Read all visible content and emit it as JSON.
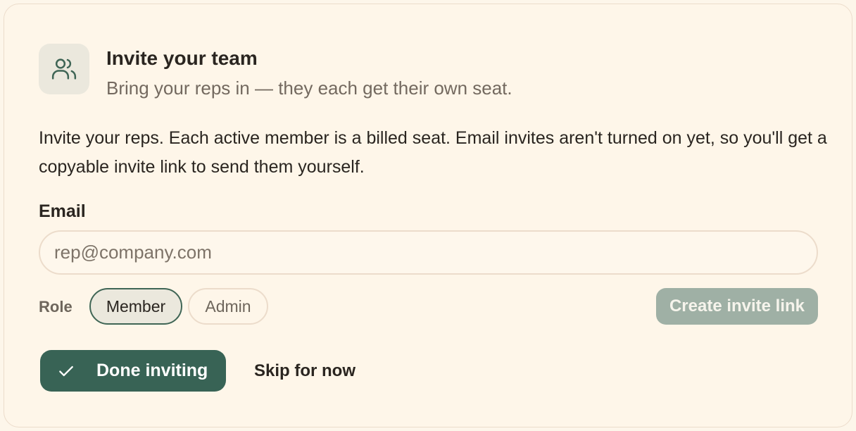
{
  "header": {
    "icon": "users-icon",
    "title": "Invite your team",
    "subtitle": "Bring your reps in — they each get their own seat."
  },
  "description": "Invite your reps. Each active member is a billed seat. Email invites aren't turned on yet, so you'll get a copyable invite link to send them yourself.",
  "email": {
    "label": "Email",
    "placeholder": "rep@company.com",
    "value": ""
  },
  "role": {
    "label": "Role",
    "options": [
      "Member",
      "Admin"
    ],
    "selected": "Member"
  },
  "actions": {
    "create_invite_link": "Create invite link",
    "done_inviting": "Done inviting",
    "skip_for_now": "Skip for now"
  },
  "colors": {
    "background": "#fef6e9",
    "accent": "#386355",
    "disabled_button": "#9fb0a5"
  }
}
